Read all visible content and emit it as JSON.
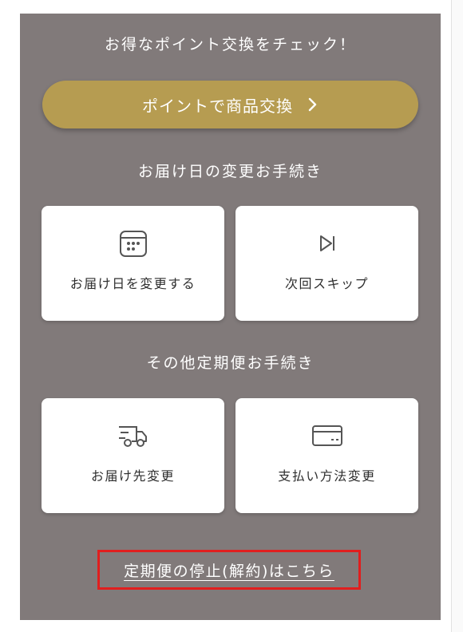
{
  "points_section": {
    "heading": "お得なポイント交換をチェック！",
    "button_label": "ポイントで商品交換"
  },
  "delivery_date_section": {
    "heading": "お届け日の変更お手続き",
    "cards": [
      {
        "label": "お届け日を変更する",
        "icon": "calendar-icon"
      },
      {
        "label": "次回スキップ",
        "icon": "skip-next-icon"
      }
    ]
  },
  "other_section": {
    "heading": "その他定期便お手続き",
    "cards": [
      {
        "label": "お届け先変更",
        "icon": "delivery-truck-icon"
      },
      {
        "label": "支払い方法変更",
        "icon": "credit-card-icon"
      }
    ]
  },
  "cancel_link": {
    "label": "定期便の停止(解約)はこちら"
  },
  "colors": {
    "panel": "#817a7a",
    "accent_gold": "#b69c51",
    "highlight_border": "#e11e1e"
  }
}
